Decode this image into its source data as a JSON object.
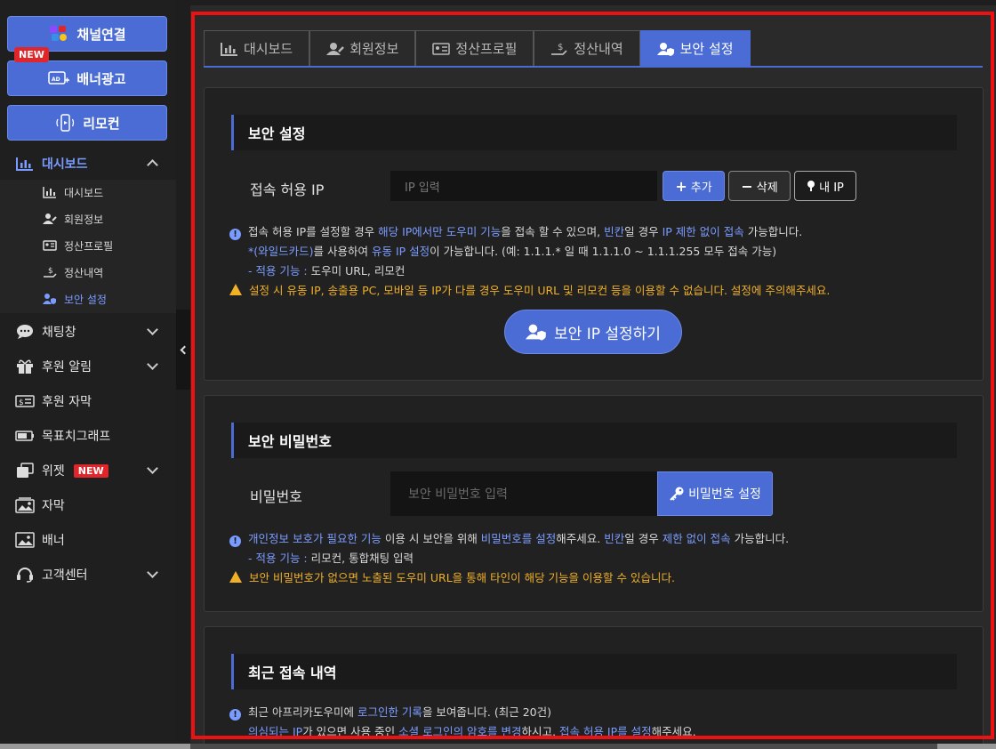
{
  "sidebar": {
    "top_buttons": {
      "channel": "채널연결",
      "banner_ad": "배너광고",
      "remote": "리모컨",
      "new_flag": "NEW"
    },
    "dashboard": {
      "label": "대시보드",
      "items": [
        "대시보드",
        "회원정보",
        "정산프로필",
        "정산내역",
        "보안 설정"
      ]
    },
    "menu": {
      "chat": "채팅창",
      "donation_alert": "후원 알림",
      "donation_caption": "후원 자막",
      "goal_graph": "목표치그래프",
      "widget": "위젯",
      "widget_badge": "NEW",
      "caption": "자막",
      "banner": "배너",
      "support": "고객센터"
    }
  },
  "tabs": [
    "대시보드",
    "회원정보",
    "정산프로필",
    "정산내역",
    "보안 설정"
  ],
  "security": {
    "title": "보안 설정",
    "ip_label": "접속 허용 IP",
    "ip_placeholder": "IP 입력",
    "add_btn": "추가",
    "delete_btn": "삭제",
    "my_ip_btn": "내 IP",
    "note1": {
      "a": "접속 허용 IP를 설정할 경우 ",
      "b": "해당 IP에서만 도우미 기능",
      "c": "을 접속 할 수 있으며, ",
      "d": "빈칸",
      "e": "일 경우 ",
      "f": "IP 제한 없이 접속",
      "g": " 가능합니다."
    },
    "note2": {
      "a": "*(와일드카드)",
      "b": "를 사용하여 ",
      "c": "유동 IP 설정",
      "d": "이 가능합니다. (예: 1.1.1.* 일 때 1.1.1.0 ~ 1.1.1.255 모두 접속 가능)"
    },
    "note3": {
      "a": "- 적용 기능 : ",
      "b": "도우미 URL, 리모컨"
    },
    "warn": "설정 시 유동 IP, 송출용 PC, 모바일 등 IP가 다를 경우 도우미 URL 및 리모컨 등을 이용할 수 없습니다. 설정에 주의해주세요.",
    "submit": "보안 IP 설정하기"
  },
  "password": {
    "title": "보안 비밀번호",
    "label": "비밀번호",
    "placeholder": "보안 비밀번호 입력",
    "btn": "비밀번호 설정",
    "note1": {
      "a": "개인정보 보호가 필요한 기능",
      "b": " 이용 시 보안을 위해 ",
      "c": "비밀번호를 설정",
      "d": "해주세요. ",
      "e": "빈칸",
      "f": "일 경우 ",
      "g": "제한 없이 접속",
      "h": " 가능합니다."
    },
    "note2": {
      "a": "- 적용 기능 : ",
      "b": "리모컨, 통합채팅 입력"
    },
    "warn": "보안 비밀번호가 없으면 노출된 도우미 URL을 통해 타인이 해당 기능을 이용할 수 있습니다."
  },
  "recent": {
    "title": "최근 접속 내역",
    "note1": {
      "a": "최근 아프리카도우미에 ",
      "b": "로그인한 기록",
      "c": "을 보여줍니다. (최근 20건)"
    },
    "note2": {
      "a": "의심되는 IP",
      "b": "가 있으면 사용 중인 ",
      "c": "소셜 로그인의 암호를 변경",
      "d": "하시고, ",
      "e": "접속 허용 IP를 설정",
      "f": "해주세요."
    }
  },
  "colors": {
    "accent": "#4a6cd4",
    "highlight": "#7b9cff",
    "warning": "#f0b028",
    "frame": "#ee1111"
  }
}
